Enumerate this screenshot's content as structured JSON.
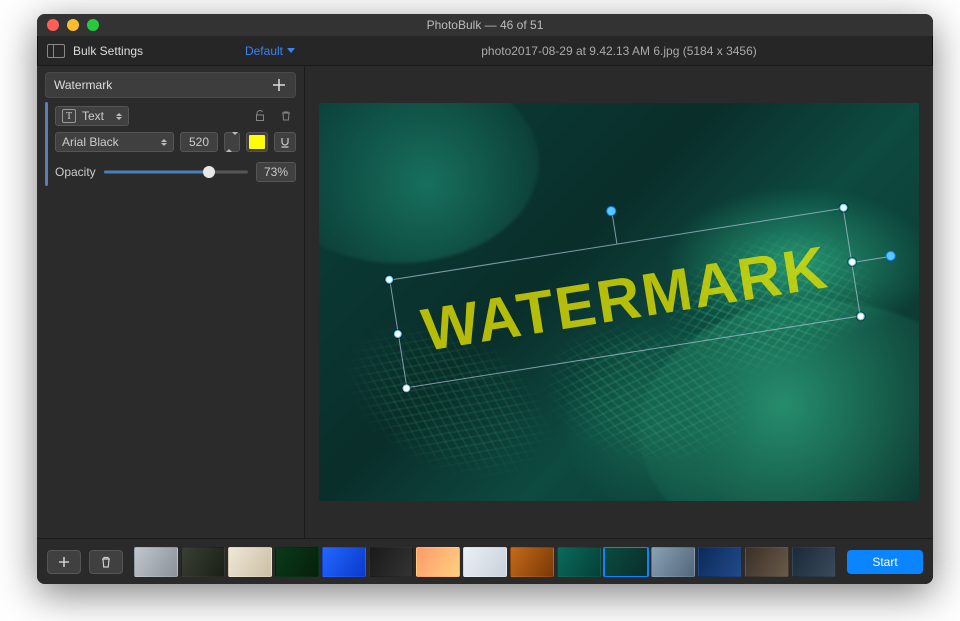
{
  "app": {
    "title": "PhotoBulk — 46 of 51"
  },
  "toolbar": {
    "bulk_settings": "Bulk Settings",
    "preset_label": "Default",
    "filename_info": "photo2017-08-29 at 9.42.13 AM 6.jpg (5184 x 3456)"
  },
  "watermark": {
    "section_title": "Watermark",
    "type_label": "Text",
    "font_name": "Arial Black",
    "font_size": "520",
    "color": "#ffff00",
    "opacity_label": "Opacity",
    "opacity_pct": "73%",
    "opacity_value": 73,
    "overlay_text": "WATERMARK"
  },
  "footer": {
    "start_label": "Start",
    "thumbnails": [
      {
        "bg": "linear-gradient(120deg,#c0c6cc,#8a929a)"
      },
      {
        "bg": "linear-gradient(120deg,#3a3f34,#1a2016)"
      },
      {
        "bg": "linear-gradient(120deg,#efe7d6,#cbbfa4)"
      },
      {
        "bg": "linear-gradient(120deg,#0a3a18,#06200c)"
      },
      {
        "bg": "linear-gradient(120deg,#2466ff,#0a3acc)"
      },
      {
        "bg": "linear-gradient(120deg,#1a1a1a,#333333)"
      },
      {
        "bg": "linear-gradient(120deg,#ff9a6b,#ffd080)"
      },
      {
        "bg": "linear-gradient(120deg,#eaeff4,#c8d2dc)"
      },
      {
        "bg": "linear-gradient(120deg,#c46a1a,#7a3807)"
      },
      {
        "bg": "linear-gradient(120deg,#0a6a5a,#054038)"
      },
      {
        "bg": "linear-gradient(120deg,#0b4a40,#0a2e2a)",
        "selected": true
      },
      {
        "bg": "linear-gradient(120deg,#8aa0b4,#52677c)"
      },
      {
        "bg": "linear-gradient(120deg,#0a2a5a,#224a8a)"
      },
      {
        "bg": "linear-gradient(120deg,#3a3028,#6a5a48)"
      },
      {
        "bg": "linear-gradient(120deg,#1a2a3a,#3a4a5a)"
      }
    ]
  }
}
